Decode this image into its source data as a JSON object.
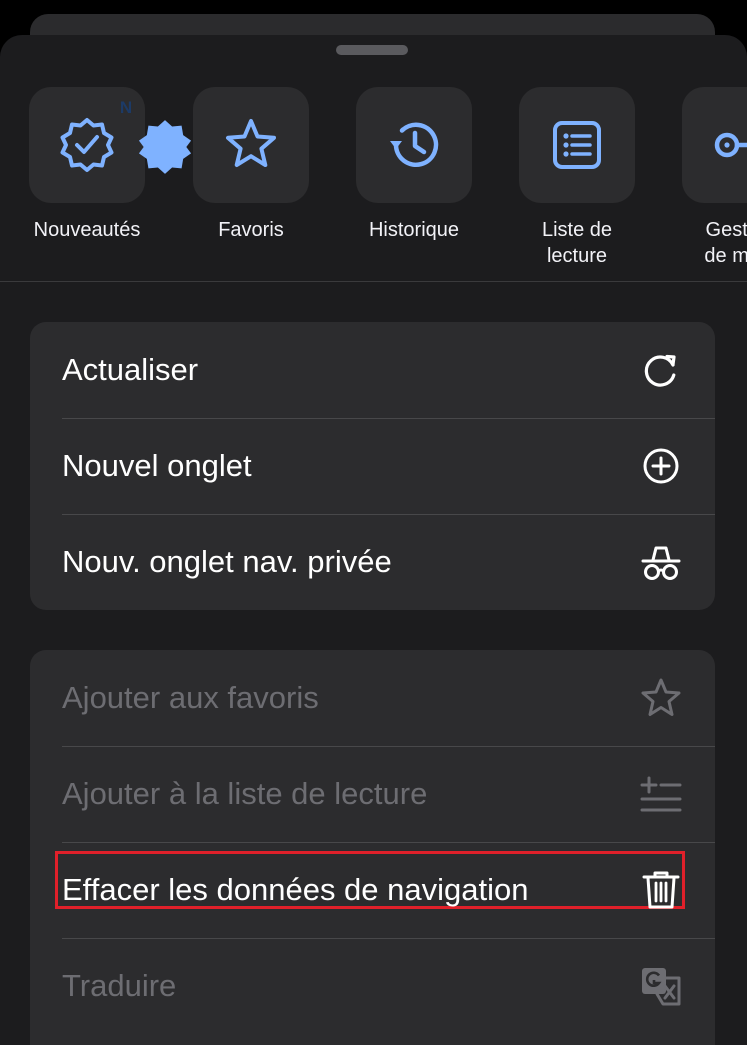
{
  "shortcuts": [
    {
      "label": "Nouveautés",
      "icon": "new-badge-icon",
      "badge": "N"
    },
    {
      "label": "Favoris",
      "icon": "star-icon"
    },
    {
      "label": "Historique",
      "icon": "history-icon"
    },
    {
      "label": "Liste de\nlecture",
      "icon": "reading-list-icon"
    },
    {
      "label": "Gestion\nde mots",
      "icon": "key-icon"
    }
  ],
  "menu_group_1": [
    {
      "label": "Actualiser",
      "icon": "reload-icon"
    },
    {
      "label": "Nouvel onglet",
      "icon": "plus-circle-icon"
    },
    {
      "label": "Nouv. onglet nav. privée",
      "icon": "incognito-icon"
    }
  ],
  "menu_group_2": [
    {
      "label": "Ajouter aux favoris",
      "icon": "star-outline-icon",
      "enabled": false
    },
    {
      "label": "Ajouter à la liste de lecture",
      "icon": "add-to-list-icon",
      "enabled": false
    },
    {
      "label": "Effacer les données de navigation",
      "icon": "trash-icon",
      "enabled": true,
      "highlighted": true
    },
    {
      "label": "Traduire",
      "icon": "translate-icon",
      "enabled": false
    }
  ],
  "colors": {
    "accent": "#7fb2ff",
    "highlight": "#e0202a",
    "disabled_text": "#6d6d72"
  }
}
